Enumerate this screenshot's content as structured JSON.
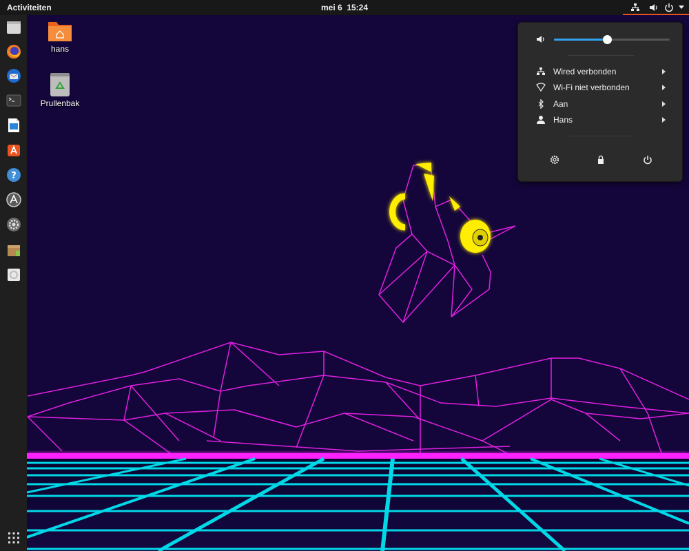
{
  "topbar": {
    "activities": "Activiteiten",
    "date": "mei 6",
    "time": "15:24"
  },
  "desktop": {
    "icons": [
      {
        "label": "hans",
        "icon": "home-folder-icon"
      },
      {
        "label": "Prullenbak",
        "icon": "trash-icon"
      }
    ]
  },
  "dock": {
    "items": [
      {
        "name": "files-icon"
      },
      {
        "name": "firefox-icon"
      },
      {
        "name": "thunderbird-icon"
      },
      {
        "name": "terminal-icon"
      },
      {
        "name": "libreoffice-writer-icon"
      },
      {
        "name": "software-center-icon"
      },
      {
        "name": "help-icon"
      },
      {
        "name": "software-updater-icon"
      },
      {
        "name": "settings-icon"
      },
      {
        "name": "archive-manager-icon"
      },
      {
        "name": "disk-image-icon"
      }
    ],
    "show_apps_icon": "grid-icon"
  },
  "system_menu": {
    "volume_level": 0.46,
    "items": [
      {
        "label": "Wired verbonden",
        "icon": "network-wired-icon"
      },
      {
        "label": "Wi-Fi niet verbonden",
        "icon": "wifi-icon"
      },
      {
        "label": "Aan",
        "icon": "bluetooth-icon"
      },
      {
        "label": "Hans",
        "icon": "user-icon"
      }
    ],
    "actions": [
      {
        "icon": "settings-icon"
      },
      {
        "icon": "lock-icon"
      },
      {
        "icon": "power-icon"
      }
    ]
  },
  "colors": {
    "accent": "#e95420",
    "slider": "#33a2ee",
    "wallpaper_bg": "#14063a",
    "wire_magenta": "#e020e0",
    "grid_cyan": "#00d8e8",
    "lamp_yellow": "#ffee00"
  }
}
